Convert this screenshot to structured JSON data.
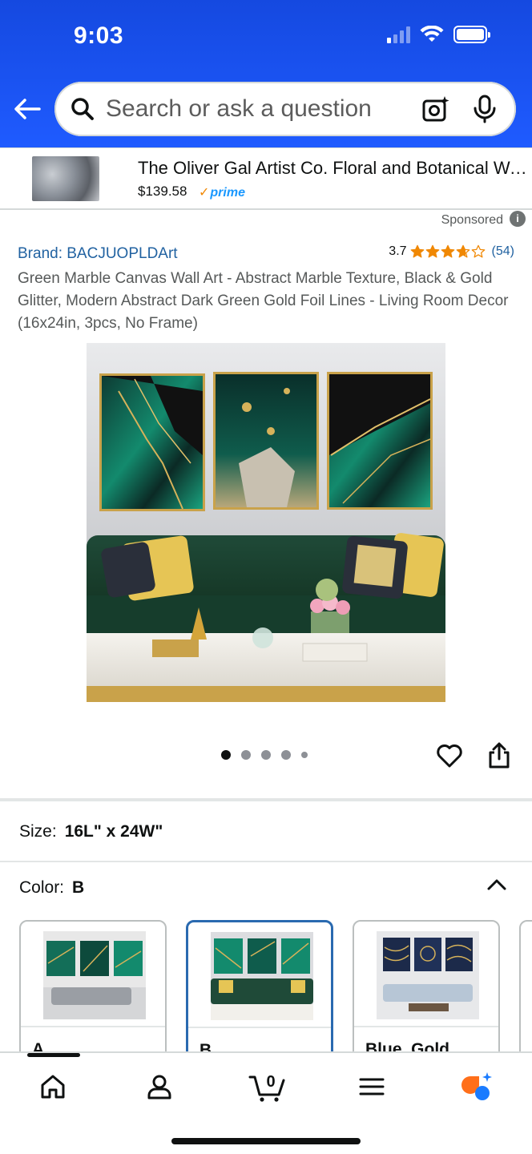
{
  "status_bar": {
    "time": "9:03"
  },
  "search": {
    "placeholder": "Search or ask a question"
  },
  "sponsored_banner": {
    "title": "The Oliver Gal Artist Co. Floral and Botanical Wall Art",
    "price": "$139.58",
    "prime_label": "prime",
    "sponsored_label": "Sponsored",
    "info_glyph": "i"
  },
  "product": {
    "brand": "Brand: BACJUOPLDArt",
    "rating_value": "3.7",
    "rating_stars": 3.7,
    "rating_count": "(54)",
    "title": "Green Marble Canvas Wall Art - Abstract Marble Texture, Black & Gold Glitter, Modern Abstract Dark Green Gold Foil Lines - Living Room Decor (16x24in, 3pcs, No Frame)"
  },
  "carousel": {
    "total_images": 5,
    "active_index": 0
  },
  "variations": {
    "size_label": "Size:",
    "size_value": "16L\" x 24W\"",
    "color_label": "Color:",
    "color_value": "B",
    "color_options": [
      {
        "label": "A",
        "selected": false
      },
      {
        "label": "B",
        "selected": true
      },
      {
        "label": "Blue, Gold",
        "selected": false
      }
    ]
  },
  "bottom_nav": {
    "items": [
      "home-icon",
      "account-icon",
      "cart-icon",
      "menu-icon",
      "rufus-assistant-icon"
    ],
    "cart_count": "0"
  },
  "colors": {
    "header_blue": "#1f5bff",
    "link_blue": "#2162a1",
    "star_orange": "#f08804",
    "prime_blue": "#1a98ff",
    "selected_border": "#2a6ab0"
  }
}
